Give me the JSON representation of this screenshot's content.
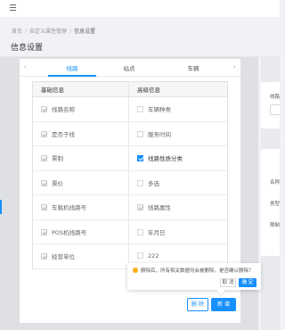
{
  "header": {
    "menu_icon": "hamburger-icon"
  },
  "breadcrumb": [
    "首页",
    "自定义属性管理",
    "信息设置"
  ],
  "page_title": "信息设置",
  "tabs": [
    "线路",
    "站点",
    "车辆"
  ],
  "active_tab": 0,
  "tab_arrows": {
    "prev": "‹",
    "next": "›"
  },
  "table": {
    "headers": [
      "基础信息",
      "高级信息"
    ],
    "rows": [
      [
        {
          "label": "线路名称",
          "state": "disabled-checked"
        },
        {
          "label": "车辆种类",
          "state": "unchecked"
        }
      ],
      [
        {
          "label": "是否子线",
          "state": "disabled-checked"
        },
        {
          "label": "服务时间",
          "state": "unchecked"
        }
      ],
      [
        {
          "label": "票制",
          "state": "disabled-checked"
        },
        {
          "label": "线路性质分类",
          "state": "checked"
        }
      ],
      [
        {
          "label": "票价",
          "state": "disabled-checked"
        },
        {
          "label": "多选",
          "state": "unchecked"
        }
      ],
      [
        {
          "label": "车载机线路号",
          "state": "disabled-checked"
        },
        {
          "label": "线路属性",
          "state": "disabled-checked"
        }
      ],
      [
        {
          "label": "POS机线路号",
          "state": "disabled-checked"
        },
        {
          "label": "年月日",
          "state": "unchecked"
        }
      ],
      [
        {
          "label": "经营单位",
          "state": "disabled-checked"
        },
        {
          "label": "222",
          "state": "unchecked"
        }
      ]
    ]
  },
  "popconfirm": {
    "icon": "warning-icon",
    "message": "删除后，所有相关数据均会被删除，是否确认删除？",
    "cancel_label": "取 消",
    "confirm_label": "确 定"
  },
  "actions": {
    "delete_label": "删 除",
    "add_label": "新 增"
  },
  "right_pane": {
    "labels": [
      "线路",
      "名称",
      "类型",
      "限制"
    ]
  },
  "colors": {
    "primary": "#1890ff",
    "warning": "#faad14"
  }
}
